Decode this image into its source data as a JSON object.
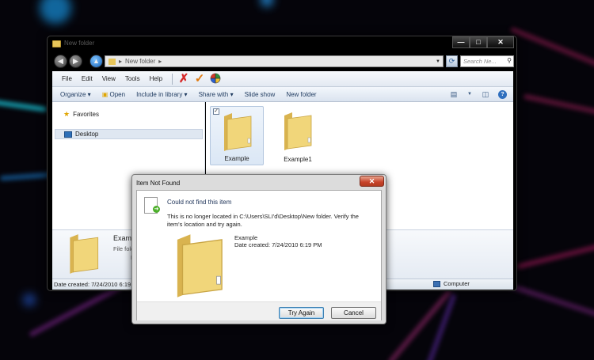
{
  "window": {
    "title": "New folder",
    "caption_buttons": {
      "minimize": "—",
      "maximize": "□",
      "close": "✕"
    }
  },
  "address_bar": {
    "breadcrumb": [
      "New folder"
    ],
    "search_placeholder": "Search Ne..."
  },
  "menu": [
    "File",
    "Edit",
    "View",
    "Tools",
    "Help"
  ],
  "toolbar_icons": [
    "delete-icon",
    "checkmark-icon",
    "colorwheel-icon"
  ],
  "commands": {
    "organize": "Organize ▾",
    "open": "Open",
    "include_in_library": "Include in library ▾",
    "share_with": "Share with ▾",
    "slide_show": "Slide show",
    "new_folder": "New folder"
  },
  "nav": {
    "favorites": "Favorites",
    "desktop": "Desktop"
  },
  "files": [
    {
      "name": "Example",
      "selected": true
    },
    {
      "name": "Example1",
      "selected": false
    }
  ],
  "details": {
    "name": "Exampl",
    "type": "File fold",
    "d": "D"
  },
  "status": {
    "left": "Date created: 7/24/2010 6:19 P",
    "right": "Computer"
  },
  "dialog": {
    "title": "Item Not Found",
    "heading": "Could not find this item",
    "message": "This is no longer located in C:\\Users\\SLI'd\\Desktop\\New folder. Verify the item's location and try again.",
    "file_name": "Example",
    "date_created": "Date created: 7/24/2010 6:19 PM",
    "try_again": "Try Again",
    "cancel": "Cancel"
  },
  "colors": {
    "folder": "#f1d67a",
    "close_button": "#c7432a",
    "selection": "#dbe7f5",
    "desktop_bg": "#05040a"
  }
}
